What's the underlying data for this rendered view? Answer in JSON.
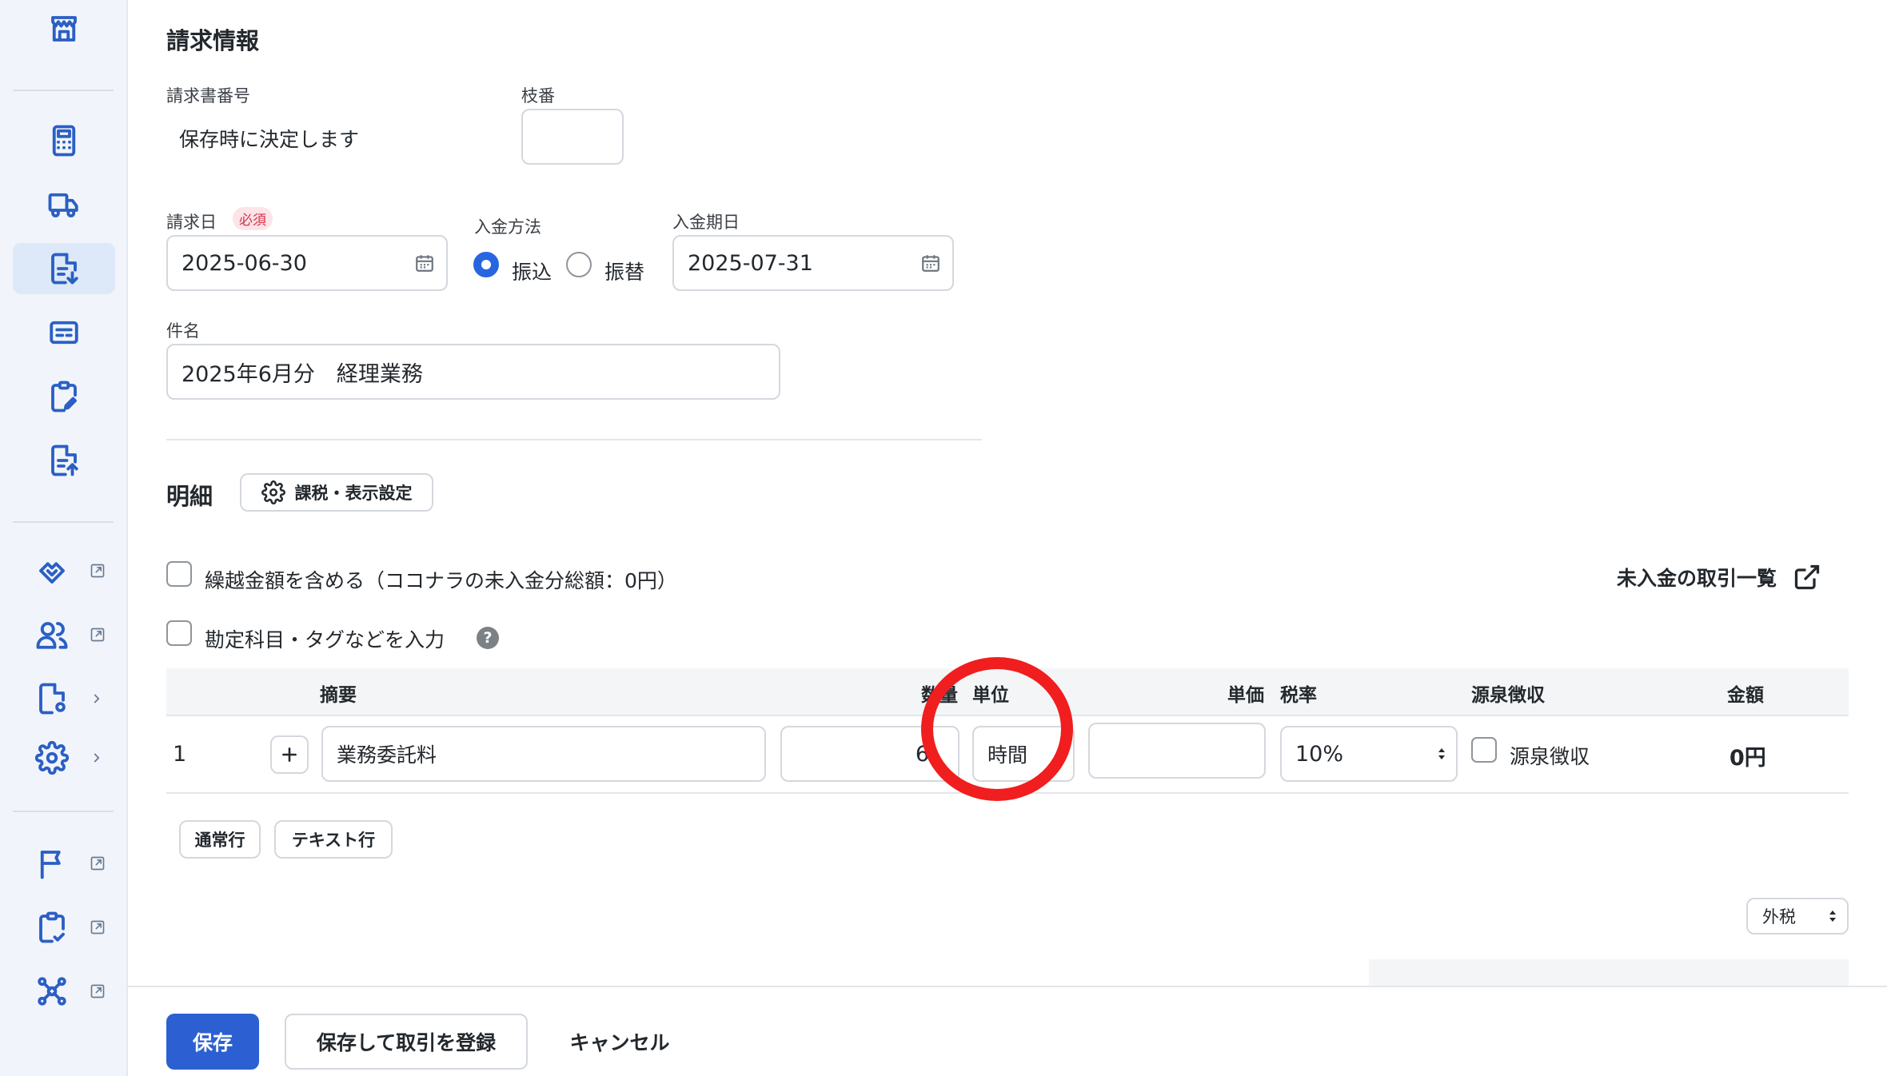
{
  "colors": {
    "accent": "#2c60d2",
    "radio_on": "#2766e0",
    "required_badge_bg": "#fce4e8",
    "required_badge_text": "#d4354b",
    "annotation": "#f01e1e"
  },
  "sidebar": {
    "items": [
      {
        "icon": "store-icon"
      },
      {
        "icon": "calculator-icon"
      },
      {
        "icon": "truck-icon"
      },
      {
        "icon": "invoice-download-icon",
        "active": true
      },
      {
        "icon": "card-icon"
      },
      {
        "icon": "clipboard-edit-icon"
      },
      {
        "icon": "document-upload-icon"
      },
      {
        "icon": "handshake-icon",
        "external": true
      },
      {
        "icon": "users-icon",
        "external": true
      },
      {
        "icon": "file-settings-icon",
        "chevron": true
      },
      {
        "icon": "gear-icon",
        "chevron": true
      },
      {
        "icon": "flag-icon",
        "external": true
      },
      {
        "icon": "clipboard-check-icon",
        "external": true
      },
      {
        "icon": "network-icon",
        "external": true
      }
    ]
  },
  "billing": {
    "title": "請求情報",
    "invoice_number_label": "請求書番号",
    "invoice_number_value": "保存時に決定します",
    "branch_label": "枝番",
    "branch_value": "",
    "invoice_date_label": "請求日",
    "required_badge": "必須",
    "invoice_date_value": "2025-06-30",
    "payment_method_label": "入金方法",
    "payment_options": [
      "振込",
      "振替"
    ],
    "payment_selected": "振込",
    "due_date_label": "入金期日",
    "due_date_value": "2025-07-31",
    "subject_label": "件名",
    "subject_value": "2025年6月分　経理業務"
  },
  "details": {
    "title": "明細",
    "settings_button": "課税・表示設定",
    "carryover_label": "繰越金額を含める（ココナラの未入金分総額：0円）",
    "carryover_checked": false,
    "unpaid_link": "未入金の取引一覧",
    "account_tag_label": "勘定科目・タグなどを入力",
    "account_tag_checked": false,
    "headers": {
      "summary": "摘要",
      "quantity": "数量",
      "unit": "単位",
      "unit_price": "単価",
      "tax_rate": "税率",
      "withholding": "源泉徴収",
      "amount": "金額"
    },
    "rows": [
      {
        "no": "1",
        "summary": "業務委託料",
        "quantity": "6",
        "unit": "時間",
        "unit_price": "",
        "tax_rate": "10%",
        "withholding_label": "源泉徴収",
        "withholding_checked": false,
        "amount": "0円"
      }
    ],
    "add_normal_row": "通常行",
    "add_text_row": "テキスト行",
    "tax_mode": "外税"
  },
  "footer": {
    "save": "保存",
    "save_and_register": "保存して取引を登録",
    "cancel": "キャンセル"
  }
}
